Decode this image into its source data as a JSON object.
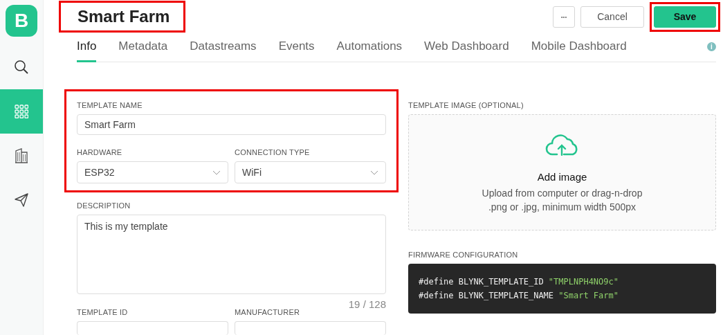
{
  "sidebar": {
    "logo": "B",
    "items": [
      {
        "kind": "search",
        "selected": false
      },
      {
        "kind": "grid",
        "selected": true
      },
      {
        "kind": "building",
        "selected": false
      },
      {
        "kind": "send",
        "selected": false
      }
    ]
  },
  "header": {
    "title": "Smart Farm",
    "title_highlighted": true,
    "more_button": "•••",
    "cancel_button": "Cancel",
    "save_button": "Save",
    "save_highlighted": true
  },
  "tabs": [
    {
      "label": "Info",
      "selected": true
    },
    {
      "label": "Metadata",
      "selected": false
    },
    {
      "label": "Datastreams",
      "selected": false
    },
    {
      "label": "Events",
      "selected": false
    },
    {
      "label": "Automations",
      "selected": false
    },
    {
      "label": "Web Dashboard",
      "selected": false
    },
    {
      "label": "Mobile Dashboard",
      "selected": false
    }
  ],
  "info_icon": "i",
  "form": {
    "highlighted": true,
    "template_name": {
      "label": "TEMPLATE NAME",
      "value": "Smart Farm"
    },
    "hardware": {
      "label": "HARDWARE",
      "value": "ESP32"
    },
    "connection_type": {
      "label": "CONNECTION TYPE",
      "value": "WiFi"
    },
    "description": {
      "label": "DESCRIPTION",
      "value": "This is my template",
      "counter": "19 / 128"
    },
    "template_id": {
      "label": "TEMPLATE ID"
    },
    "manufacturer": {
      "label": "MANUFACTURER"
    }
  },
  "template_image": {
    "label": "TEMPLATE IMAGE (OPTIONAL)",
    "title": "Add image",
    "hint_lines": [
      "Upload from computer or drag-n-drop",
      ".png or .jpg, minimum width 500px"
    ]
  },
  "firmware": {
    "label": "FIRMWARE CONFIGURATION",
    "lines": [
      {
        "directive": "#define",
        "name": "BLYNK_TEMPLATE_ID",
        "value": "\"TMPLNPH4NO9c\""
      },
      {
        "directive": "#define",
        "name": "BLYNK_TEMPLATE_NAME",
        "value": "\"Smart Farm\""
      }
    ]
  }
}
